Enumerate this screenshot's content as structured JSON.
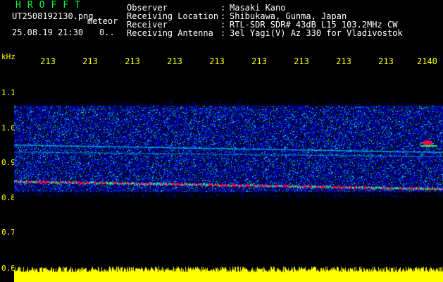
{
  "header": {
    "app_title": "HROFFT",
    "filename": "UT2508192130.png",
    "mode": "meteor",
    "datetime": "25.08.19 21:30",
    "extra": "0..",
    "info": [
      {
        "label": "Observer",
        "value": "Masaki Kano"
      },
      {
        "label": "Receiving Location",
        "value": "Shibukawa, Gunma, Japan"
      },
      {
        "label": "Receiver",
        "value": "RTL-SDR SDR# 43dB L15 103.2MHz CW"
      },
      {
        "label": "Receiving Antenna",
        "value": "3el Yagi(V) Az 330 for Vladivostok"
      }
    ]
  },
  "axis": {
    "unit": "kHz",
    "x_ticks": [
      "213",
      "213",
      "213",
      "213",
      "213",
      "213",
      "213",
      "213",
      "213",
      "2140"
    ],
    "y_ticks": [
      "1.1",
      "1.0",
      "0.9",
      "0.8",
      "0.7",
      "0.6"
    ]
  },
  "colors": {
    "background": "#000000",
    "title": "#00ff40",
    "axis_text": "#ffff00",
    "noise_low": "#0000ff",
    "noise_mid": "#00ffff",
    "signal": "#ff0050",
    "amplitude": "#ffff00"
  },
  "spectrogram": {
    "freq_range_khz": [
      0.6,
      1.13
    ],
    "noise_band_khz": [
      0.8,
      1.03
    ],
    "carrier_khz": [
      0.83,
      0.81
    ],
    "secondary_lines_khz": [
      0.925,
      0.905
    ],
    "echo_khz": 0.93
  }
}
